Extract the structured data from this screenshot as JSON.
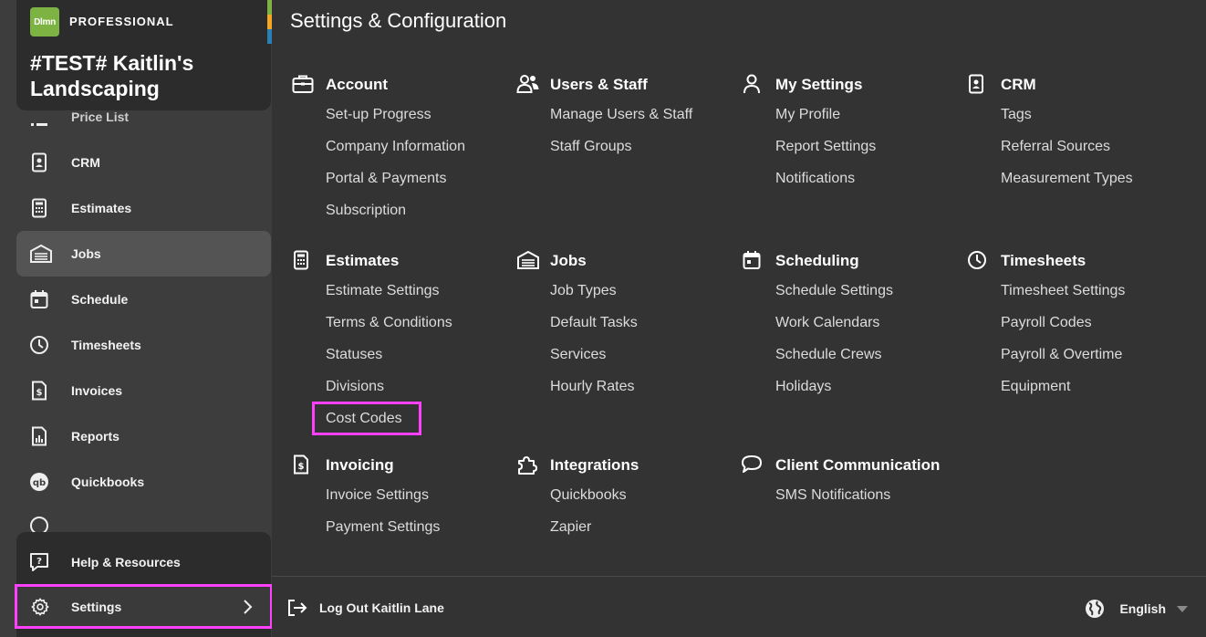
{
  "sidebar": {
    "logo_text": "Dlmn",
    "plan": "PROFESSIONAL",
    "company": "#TEST# Kaitlin's Landscaping",
    "strip_colors": [
      "#7cb342",
      "#f5a623",
      "#2a7fb8"
    ],
    "partial_item": "Price List",
    "items": [
      {
        "label": "CRM",
        "icon": "contact-card-icon"
      },
      {
        "label": "Estimates",
        "icon": "calculator-icon"
      },
      {
        "label": "Jobs",
        "icon": "garage-icon",
        "active": true
      },
      {
        "label": "Schedule",
        "icon": "calendar-icon"
      },
      {
        "label": "Timesheets",
        "icon": "clock-icon"
      },
      {
        "label": "Invoices",
        "icon": "invoice-icon"
      },
      {
        "label": "Reports",
        "icon": "report-icon"
      },
      {
        "label": "Quickbooks",
        "icon": "quickbooks-icon"
      }
    ],
    "help": "Help & Resources",
    "settings": "Settings"
  },
  "main": {
    "title": "Settings & Configuration",
    "sections": {
      "account": {
        "title": "Account",
        "items": [
          "Set-up Progress",
          "Company Information",
          "Portal & Payments",
          "Subscription"
        ]
      },
      "users": {
        "title": "Users & Staff",
        "items": [
          "Manage Users & Staff",
          "Staff Groups"
        ]
      },
      "my_settings": {
        "title": "My Settings",
        "items": [
          "My Profile",
          "Report Settings",
          "Notifications"
        ]
      },
      "crm": {
        "title": "CRM",
        "items": [
          "Tags",
          "Referral Sources",
          "Measurement Types"
        ]
      },
      "estimates": {
        "title": "Estimates",
        "items": [
          "Estimate Settings",
          "Terms & Conditions",
          "Statuses",
          "Divisions",
          "Cost Codes"
        ]
      },
      "jobs": {
        "title": "Jobs",
        "items": [
          "Job Types",
          "Default Tasks",
          "Services",
          "Hourly Rates"
        ]
      },
      "scheduling": {
        "title": "Scheduling",
        "items": [
          "Schedule Settings",
          "Work Calendars",
          "Schedule Crews",
          "Holidays"
        ]
      },
      "timesheets": {
        "title": "Timesheets",
        "items": [
          "Timesheet Settings",
          "Payroll Codes",
          "Payroll & Overtime",
          "Equipment"
        ]
      },
      "invoicing": {
        "title": "Invoicing",
        "items": [
          "Invoice Settings",
          "Payment Settings"
        ]
      },
      "integrations": {
        "title": "Integrations",
        "items": [
          "Quickbooks",
          "Zapier"
        ]
      },
      "client_comm": {
        "title": "Client Communication",
        "items": [
          "SMS Notifications"
        ]
      }
    }
  },
  "footer": {
    "logout": "Log Out Kaitlin Lane",
    "language": "English"
  },
  "colors": {
    "highlight": "#ff40ff",
    "brand_green": "#7cb342"
  }
}
